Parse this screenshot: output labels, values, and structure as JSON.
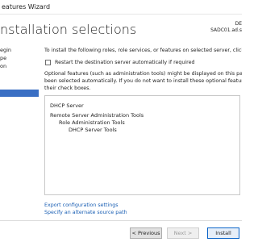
{
  "window": {
    "title": "eatures Wizard"
  },
  "page": {
    "title": "nstallation selections"
  },
  "destination": {
    "line1": "DE",
    "line2": "SADC01.ad.s"
  },
  "nav": {
    "items": [
      {
        "label": "egin"
      },
      {
        "label": "pe"
      },
      {
        "label": "on"
      },
      {
        "label": ""
      }
    ]
  },
  "main": {
    "intro": "To install the following roles, role services, or features on selected server, click Install.",
    "restart_checkbox": {
      "label": "Restart the destination server automatically if required",
      "checked": false
    },
    "optional_lines": [
      "Optional features (such as administration tools) might be displayed on this page becau",
      "been selected automatically. If you do not want to install these optional features, click",
      "their check boxes."
    ],
    "features": [
      {
        "label": "DHCP Server",
        "level": 0
      },
      {
        "label": "Remote Server Administration Tools",
        "level": 0
      },
      {
        "label": "Role Administration Tools",
        "level": 1
      },
      {
        "label": "DHCP Server Tools",
        "level": 2
      }
    ],
    "links": {
      "export": "Export configuration settings",
      "alternate_source": "Specify an alternate source path"
    }
  },
  "buttons": {
    "previous": "< Previous",
    "next": "Next >",
    "install": "Install"
  },
  "colors": {
    "selected_nav": "#3a6fc4",
    "link": "#1a5fb4"
  }
}
